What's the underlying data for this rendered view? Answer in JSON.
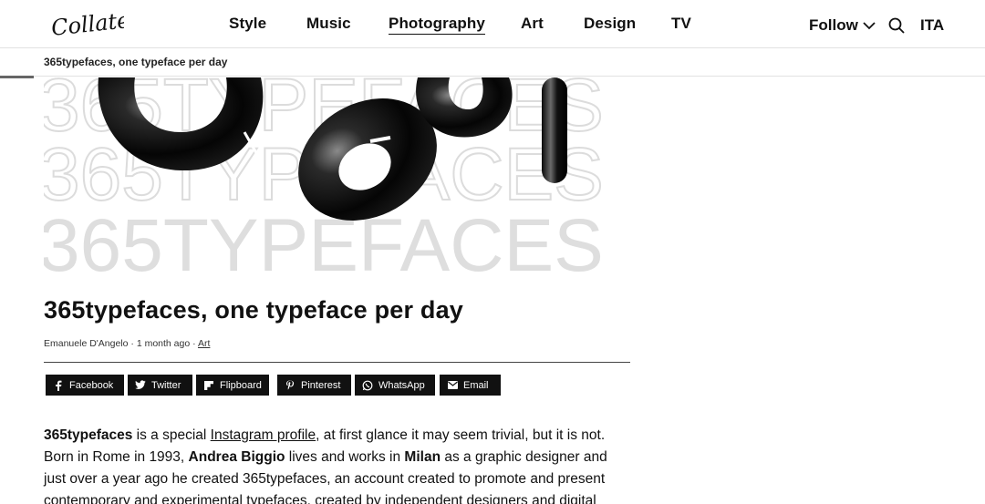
{
  "brand": {
    "logo_text": "Collateral"
  },
  "nav": {
    "items": [
      {
        "label": "Style",
        "active": false
      },
      {
        "label": "Music",
        "active": false
      },
      {
        "label": "Photography",
        "active": true
      },
      {
        "label": "Art",
        "active": false
      },
      {
        "label": "Design",
        "active": false
      },
      {
        "label": "TV",
        "active": false
      }
    ],
    "follow_label": "Follow",
    "lang_label": "ITA"
  },
  "breadcrumb": {
    "current": "365typefaces, one typeface per day"
  },
  "hero": {
    "background_text": "365TYPEFACES"
  },
  "article": {
    "title": "365typefaces, one typeface per day",
    "author": "Emanuele D'Angelo",
    "sep1": " · ",
    "time": "1 month ago",
    "sep2": " · ",
    "category": "Art",
    "share": [
      {
        "label": "Facebook",
        "icon": "facebook-icon"
      },
      {
        "label": "Twitter",
        "icon": "twitter-icon"
      },
      {
        "label": "Flipboard",
        "icon": "flipboard-icon"
      },
      {
        "label": "Pinterest",
        "icon": "pinterest-icon"
      },
      {
        "label": "WhatsApp",
        "icon": "whatsapp-icon"
      },
      {
        "label": "Email",
        "icon": "email-icon"
      }
    ],
    "body": {
      "b1": "365typefaces",
      "t1": " is a special ",
      "link1": "Instagram profile",
      "t2": ", at first glance it may seem trivial, but it is not. Born in Rome in 1993, ",
      "b2": "Andrea Biggio",
      "t3": " lives and works in ",
      "b3": "Milan",
      "t4": " as a graphic designer and just over a year ago he created 365typefaces, an account created to promote and present contemporary and experimental typefaces, created by independent designers and digital"
    }
  },
  "colors": {
    "text": "#111111",
    "share_bg": "#111111",
    "divider": "#e2e2e2",
    "hero_text": "#dddddd"
  }
}
